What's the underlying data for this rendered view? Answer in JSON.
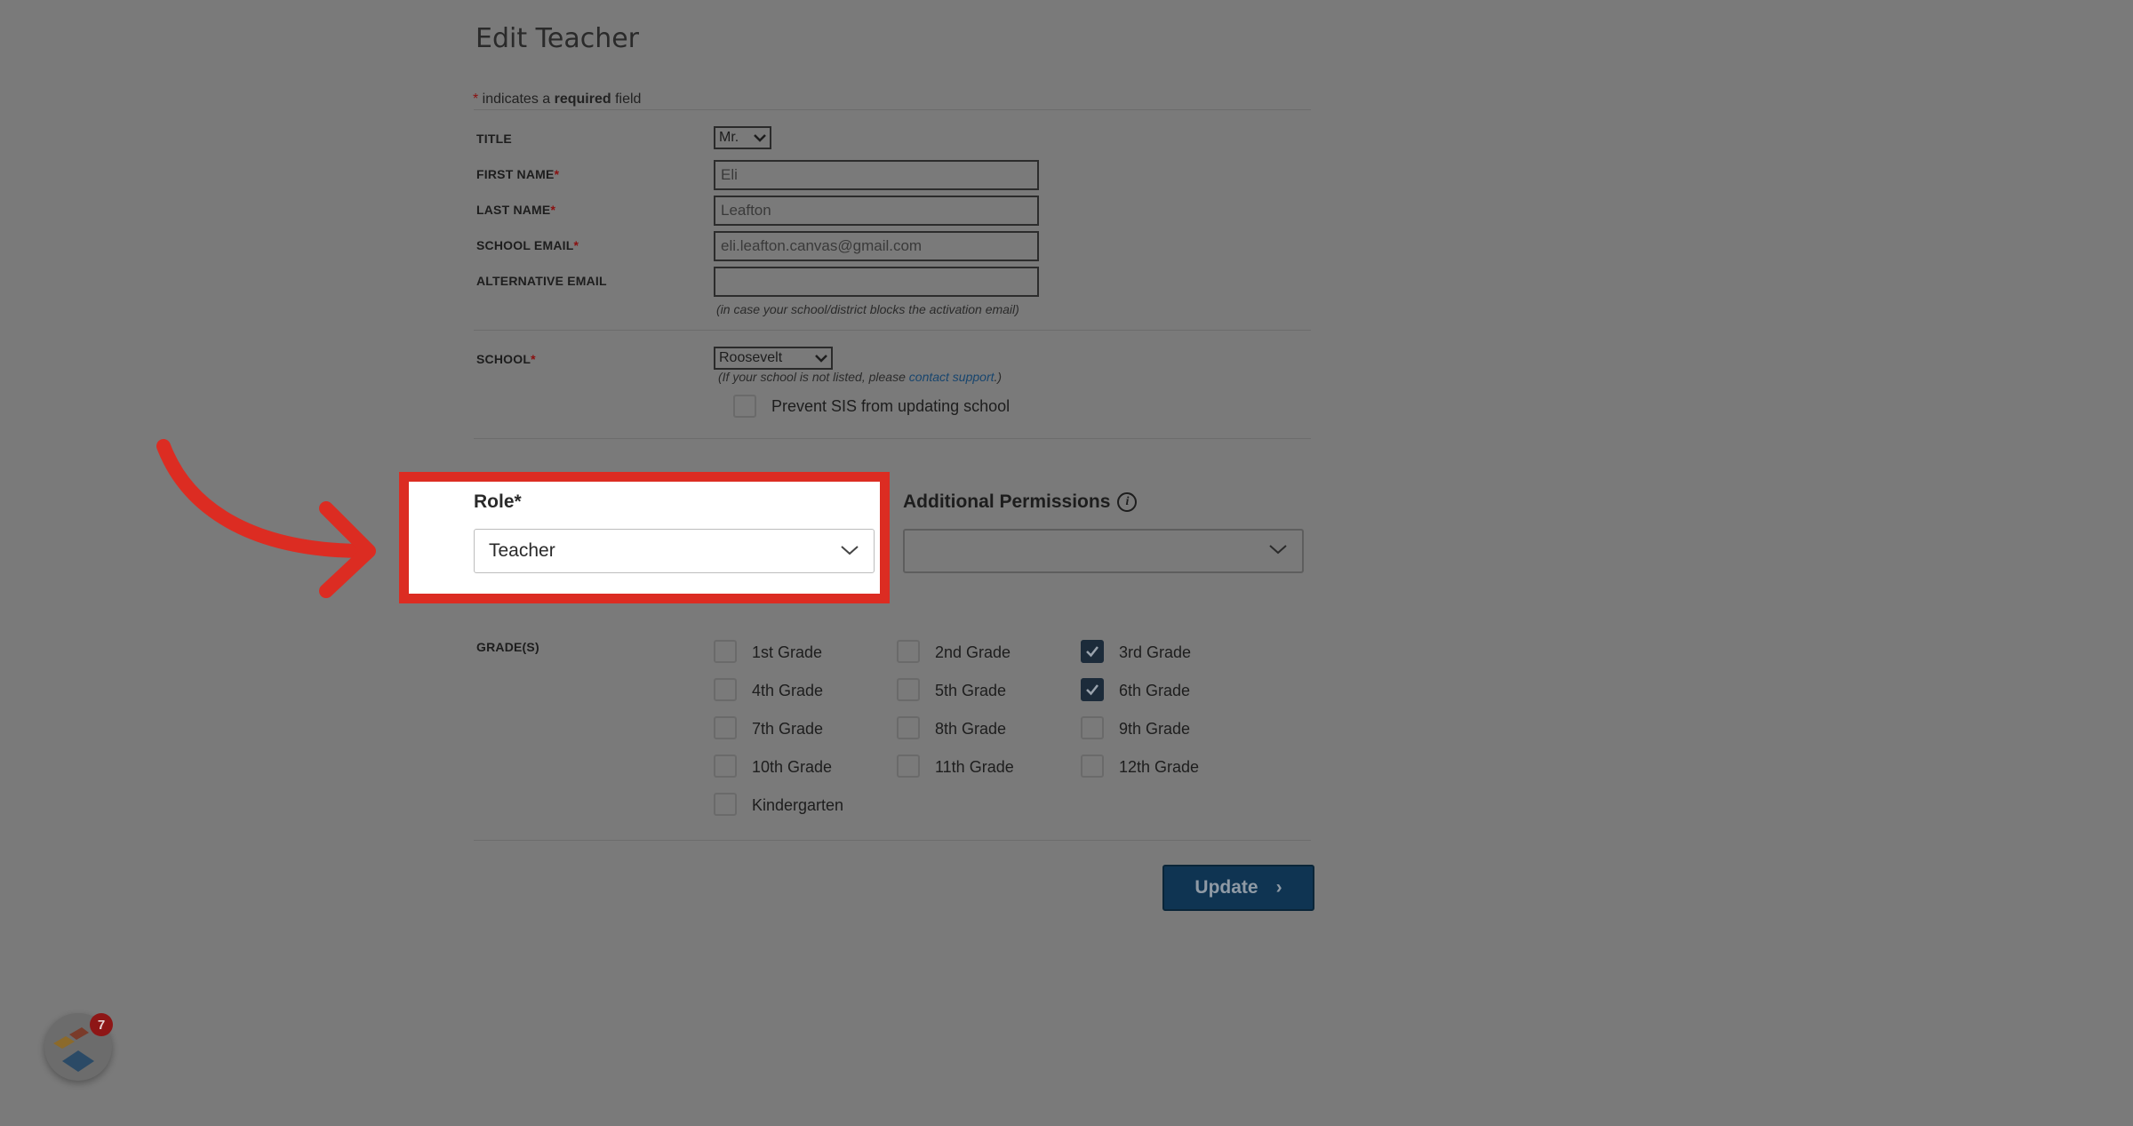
{
  "page": {
    "title": "Edit Teacher"
  },
  "required_note": {
    "star": "*",
    "before": " indicates a ",
    "bold": "required",
    "after": " field"
  },
  "fields": {
    "title": {
      "label": "TITLE",
      "value": "Mr."
    },
    "first_name": {
      "label": "FIRST NAME",
      "star": "*",
      "value": "Eli"
    },
    "last_name": {
      "label": "LAST NAME",
      "star": "*",
      "value": "Leafton"
    },
    "school_email": {
      "label": "SCHOOL EMAIL",
      "star": "*",
      "value": "eli.leafton.canvas@gmail.com"
    },
    "alternative_email": {
      "label": "ALTERNATIVE EMAIL",
      "value": "",
      "hint": "(in case your school/district blocks the activation email)"
    },
    "school": {
      "label": "SCHOOL",
      "star": "*",
      "value": "Roosevelt",
      "hint_before": "(If your school is not listed, please ",
      "hint_link": "contact support",
      "hint_after": ".)",
      "prevent_sis_label": "Prevent SIS from updating school",
      "prevent_sis_checked": false
    }
  },
  "role": {
    "label": "Role*",
    "value": "Teacher"
  },
  "additional_permissions": {
    "label": "Additional Permissions",
    "info_glyph": "i",
    "value": ""
  },
  "grades": {
    "label": "GRADE(S)",
    "items": [
      {
        "label": "1st Grade",
        "checked": false
      },
      {
        "label": "2nd Grade",
        "checked": false
      },
      {
        "label": "3rd Grade",
        "checked": true
      },
      {
        "label": "4th Grade",
        "checked": false
      },
      {
        "label": "5th Grade",
        "checked": false
      },
      {
        "label": "6th Grade",
        "checked": true
      },
      {
        "label": "7th Grade",
        "checked": false
      },
      {
        "label": "8th Grade",
        "checked": false
      },
      {
        "label": "9th Grade",
        "checked": false
      },
      {
        "label": "10th Grade",
        "checked": false
      },
      {
        "label": "11th Grade",
        "checked": false
      },
      {
        "label": "12th Grade",
        "checked": false
      },
      {
        "label": "Kindergarten",
        "checked": false
      }
    ]
  },
  "update_button": {
    "label": "Update",
    "chevron": "›"
  },
  "app_widget": {
    "badge_count": "7"
  },
  "colors": {
    "overlay": "#7a7a7a",
    "highlight": "#dc2c22",
    "button": "#0f3452",
    "star": "#8a1010"
  }
}
